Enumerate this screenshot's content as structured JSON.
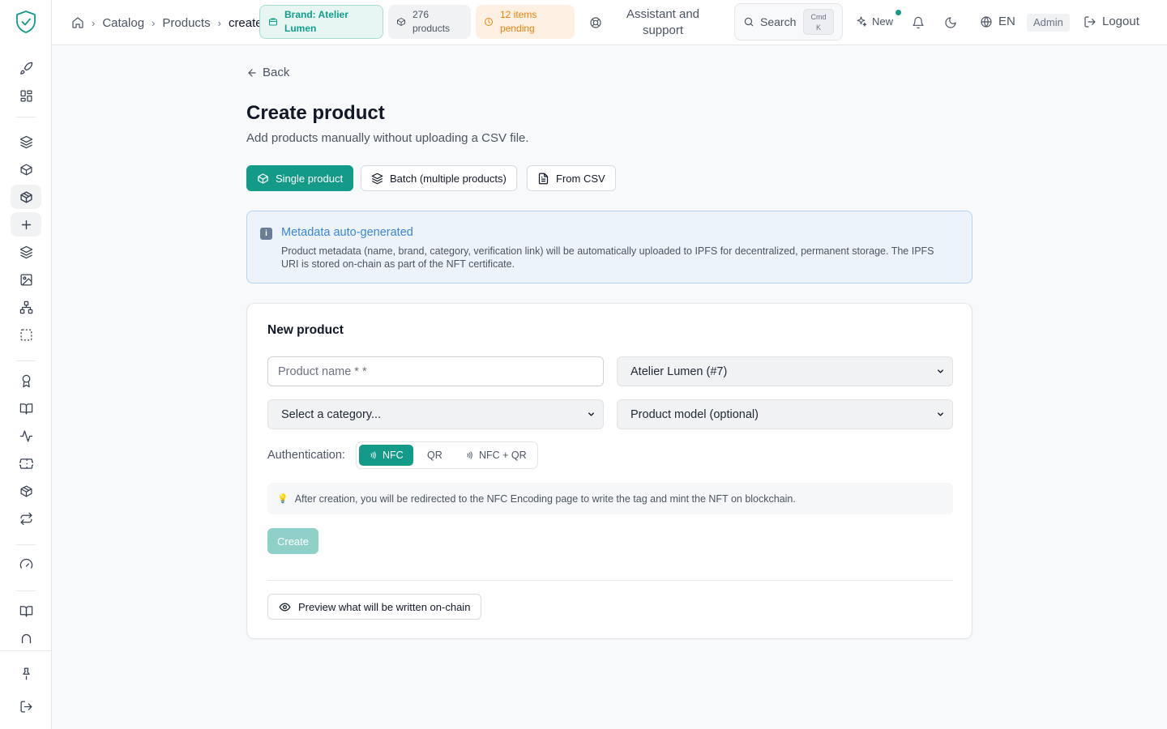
{
  "header": {
    "breadcrumb": [
      "Catalog",
      "Products",
      "create"
    ],
    "brand_pill": "Brand: Atelier Lumen",
    "products_pill": "276 products",
    "pending_pill": "12 items pending",
    "assistant": "Assistant and support",
    "search_label": "Search",
    "kbd_line1": "Cmd",
    "kbd_line2": "K",
    "new_label": "New",
    "lang": "EN",
    "role": "Admin",
    "logout": "Logout"
  },
  "page": {
    "back": "Back",
    "title": "Create product",
    "subtitle": "Add products manually without uploading a CSV file.",
    "modes": [
      "Single product",
      "Batch (multiple products)",
      "From CSV"
    ],
    "active_mode": "Single product"
  },
  "info": {
    "title": "Metadata auto-generated",
    "text": "Product metadata (name, brand, category, verification link) will be automatically uploaded to IPFS for decentralized, permanent storage. The IPFS URI is stored on-chain as part of the NFT certificate."
  },
  "form": {
    "title": "New product",
    "name_placeholder": "Product name * *",
    "brand_selected": "Atelier Lumen (#7)",
    "category_selected": "Select a category...",
    "model_selected": "Product model (optional)",
    "auth_label": "Authentication:",
    "auth_options": [
      "NFC",
      "QR",
      "NFC + QR"
    ],
    "auth_selected": "NFC",
    "tip": "After creation, you will be redirected to the NFC Encoding page to write the tag and mint the NFT on blockchain.",
    "create_label": "Create",
    "preview_label": "Preview what will be written on-chain"
  },
  "colors": {
    "accent": "#149a89",
    "info_bg": "#edf3fb",
    "info_title": "#3b86d6",
    "pending": "#e8820c"
  },
  "icons": {
    "sidebar": [
      "rocket-icon",
      "grid-icon",
      "layers-icon",
      "box-icon",
      "package-icon",
      "plus-icon",
      "layers-icon",
      "image-icon",
      "sitemap-icon",
      "select-icon",
      "award-icon",
      "book-icon",
      "activity-icon",
      "ticket-icon",
      "package-icon",
      "repeat-icon",
      "gauge-icon",
      "book-icon",
      "arch-icon",
      "pin-icon",
      "logout-icon"
    ]
  }
}
